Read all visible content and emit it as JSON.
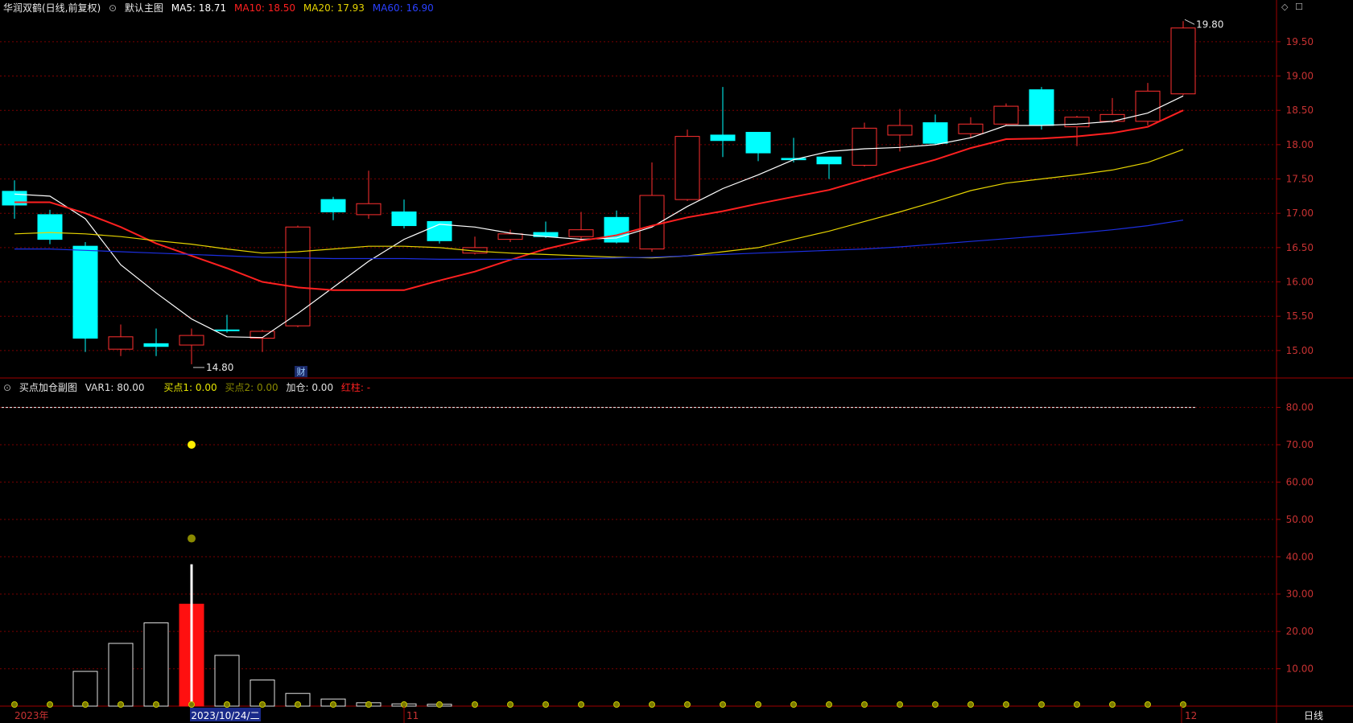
{
  "main_panel": {
    "stock_title": "华润双鹤(日线,前复权)",
    "indicator_name": "默认主图",
    "legend": [
      {
        "label": "MA5: 18.71",
        "color": "#ffffff"
      },
      {
        "label": "MA10: 18.50",
        "color": "#ff2020"
      },
      {
        "label": "MA20: 17.93",
        "color": "#e6d400"
      },
      {
        "label": "MA60: 16.90",
        "color": "#1c2fe0"
      }
    ],
    "high_marker": "19.80",
    "low_marker": "14.80",
    "event_tag": "财"
  },
  "sub_panel": {
    "name": "买点加仓副图",
    "legend": [
      {
        "label": "VAR1: 80.00",
        "color": "#e0e0e0"
      },
      {
        "label": "买点1: 0.00",
        "color": "#e6e600"
      },
      {
        "label": "买点2: 0.00",
        "color": "#8a8a00"
      },
      {
        "label": "加仓: 0.00",
        "color": "#e0e0e0"
      },
      {
        "label": "红柱: -",
        "color": "#ff2020"
      }
    ]
  },
  "x_axis": {
    "labels": [
      "2023年",
      "11",
      "12"
    ],
    "selected_date": "2023/10/24/二",
    "period": "日线"
  },
  "colors": {
    "up": "#ff3030",
    "down": "#00ffff",
    "grid": "#7a0000",
    "axis": "#a00000",
    "axis_text": "#c83232"
  },
  "chart_data": [
    {
      "type": "candlestick",
      "title": "华润双鹤(日线,前复权)",
      "ylim": [
        14.6,
        19.85
      ],
      "yticks": [
        15.0,
        15.5,
        16.0,
        16.5,
        17.0,
        17.5,
        18.0,
        18.5,
        19.0,
        19.5
      ],
      "candles": [
        {
          "o": 17.32,
          "h": 17.48,
          "l": 16.92,
          "c": 17.12
        },
        {
          "o": 16.98,
          "h": 17.05,
          "l": 16.55,
          "c": 16.62
        },
        {
          "o": 16.52,
          "h": 16.58,
          "l": 14.98,
          "c": 15.18
        },
        {
          "o": 15.02,
          "h": 15.38,
          "l": 14.92,
          "c": 15.2
        },
        {
          "o": 15.1,
          "h": 15.32,
          "l": 14.92,
          "c": 15.06
        },
        {
          "o": 15.08,
          "h": 15.32,
          "l": 14.8,
          "c": 15.22
        },
        {
          "o": 15.3,
          "h": 15.52,
          "l": 15.26,
          "c": 15.29
        },
        {
          "o": 15.18,
          "h": 15.3,
          "l": 14.98,
          "c": 15.28
        },
        {
          "o": 15.36,
          "h": 16.82,
          "l": 15.34,
          "c": 16.8
        },
        {
          "o": 17.2,
          "h": 17.24,
          "l": 16.9,
          "c": 17.02
        },
        {
          "o": 16.98,
          "h": 17.62,
          "l": 16.92,
          "c": 17.14
        },
        {
          "o": 17.02,
          "h": 17.2,
          "l": 16.78,
          "c": 16.82
        },
        {
          "o": 16.88,
          "h": 16.88,
          "l": 16.56,
          "c": 16.6
        },
        {
          "o": 16.42,
          "h": 16.66,
          "l": 16.4,
          "c": 16.5
        },
        {
          "o": 16.62,
          "h": 16.76,
          "l": 16.58,
          "c": 16.7
        },
        {
          "o": 16.72,
          "h": 16.88,
          "l": 16.64,
          "c": 16.66
        },
        {
          "o": 16.66,
          "h": 17.02,
          "l": 16.6,
          "c": 16.76
        },
        {
          "o": 16.94,
          "h": 17.04,
          "l": 16.56,
          "c": 16.58
        },
        {
          "o": 16.48,
          "h": 17.74,
          "l": 16.44,
          "c": 17.26
        },
        {
          "o": 17.2,
          "h": 18.22,
          "l": 17.18,
          "c": 18.12
        },
        {
          "o": 18.14,
          "h": 18.84,
          "l": 17.82,
          "c": 18.06
        },
        {
          "o": 18.18,
          "h": 18.18,
          "l": 17.76,
          "c": 17.88
        },
        {
          "o": 17.8,
          "h": 18.1,
          "l": 17.74,
          "c": 17.78
        },
        {
          "o": 17.82,
          "h": 17.82,
          "l": 17.5,
          "c": 17.72
        },
        {
          "o": 17.7,
          "h": 18.32,
          "l": 17.68,
          "c": 18.24
        },
        {
          "o": 18.14,
          "h": 18.52,
          "l": 17.9,
          "c": 18.28
        },
        {
          "o": 18.32,
          "h": 18.44,
          "l": 18.0,
          "c": 18.02
        },
        {
          "o": 18.16,
          "h": 18.4,
          "l": 18.1,
          "c": 18.3
        },
        {
          "o": 18.3,
          "h": 18.6,
          "l": 18.28,
          "c": 18.56
        },
        {
          "o": 18.8,
          "h": 18.84,
          "l": 18.22,
          "c": 18.28
        },
        {
          "o": 18.26,
          "h": 18.42,
          "l": 17.98,
          "c": 18.4
        },
        {
          "o": 18.34,
          "h": 18.68,
          "l": 18.32,
          "c": 18.44
        },
        {
          "o": 18.34,
          "h": 18.9,
          "l": 18.28,
          "c": 18.78
        },
        {
          "o": 18.74,
          "h": 19.8,
          "l": 18.72,
          "c": 19.7
        }
      ],
      "series": [
        {
          "name": "MA5",
          "color": "#ffffff",
          "values": [
            17.28,
            17.25,
            16.92,
            16.25,
            15.84,
            15.46,
            15.2,
            15.19,
            15.54,
            15.92,
            16.3,
            16.62,
            16.84,
            16.8,
            16.71,
            16.66,
            16.62,
            16.64,
            16.8,
            17.1,
            17.36,
            17.56,
            17.78,
            17.9,
            17.94,
            17.96,
            18.0,
            18.1,
            18.28,
            18.28,
            18.3,
            18.34,
            18.46,
            18.71
          ]
        },
        {
          "name": "MA10",
          "color": "#ff2020",
          "values": [
            17.16,
            17.16,
            17.0,
            16.8,
            16.56,
            16.38,
            16.2,
            16.0,
            15.92,
            15.88,
            15.88,
            15.88,
            16.02,
            16.15,
            16.32,
            16.48,
            16.6,
            16.68,
            16.82,
            16.94,
            17.03,
            17.14,
            17.24,
            17.34,
            17.49,
            17.64,
            17.78,
            17.95,
            18.08,
            18.09,
            18.12,
            18.17,
            18.26,
            18.5
          ]
        },
        {
          "name": "MA20",
          "color": "#e6d400",
          "values": [
            16.7,
            16.72,
            16.7,
            16.66,
            16.6,
            16.55,
            16.48,
            16.42,
            16.44,
            16.48,
            16.52,
            16.52,
            16.5,
            16.45,
            16.42,
            16.4,
            16.38,
            16.36,
            16.35,
            16.38,
            16.44,
            16.5,
            16.62,
            16.74,
            16.88,
            17.02,
            17.17,
            17.33,
            17.44,
            17.5,
            17.56,
            17.63,
            17.74,
            17.93
          ]
        },
        {
          "name": "MA60",
          "color": "#1c2fe0",
          "values": [
            16.48,
            16.48,
            16.46,
            16.44,
            16.42,
            16.4,
            16.38,
            16.36,
            16.35,
            16.34,
            16.34,
            16.34,
            16.33,
            16.33,
            16.33,
            16.33,
            16.34,
            16.35,
            16.36,
            16.38,
            16.4,
            16.42,
            16.44,
            16.46,
            16.48,
            16.51,
            16.55,
            16.59,
            16.63,
            16.67,
            16.71,
            16.76,
            16.82,
            16.9
          ]
        }
      ]
    },
    {
      "type": "bar",
      "title": "买点加仓副图",
      "ylim": [
        0,
        84
      ],
      "yticks": [
        10.0,
        20.0,
        30.0,
        40.0,
        50.0,
        60.0,
        70.0,
        80.0
      ],
      "var1_line": 80.0,
      "bars": [
        0,
        0,
        9.3,
        16.8,
        22.3,
        27.3,
        13.6,
        7.0,
        3.4,
        1.9,
        0.9,
        0.6,
        0.5,
        0,
        0,
        0,
        0,
        0,
        0,
        0,
        0,
        0,
        0,
        0,
        0,
        0,
        0,
        0,
        0,
        0,
        0,
        0,
        0,
        0
      ],
      "red_bar_index": 5,
      "jiacang": [
        {
          "index": 5,
          "value": 38.0
        }
      ],
      "buy1": [
        {
          "index": 5,
          "value": 70.0
        }
      ],
      "buy2": [
        {
          "index": 5,
          "value": 44.9
        }
      ],
      "baseline_markers": 0.0
    }
  ]
}
